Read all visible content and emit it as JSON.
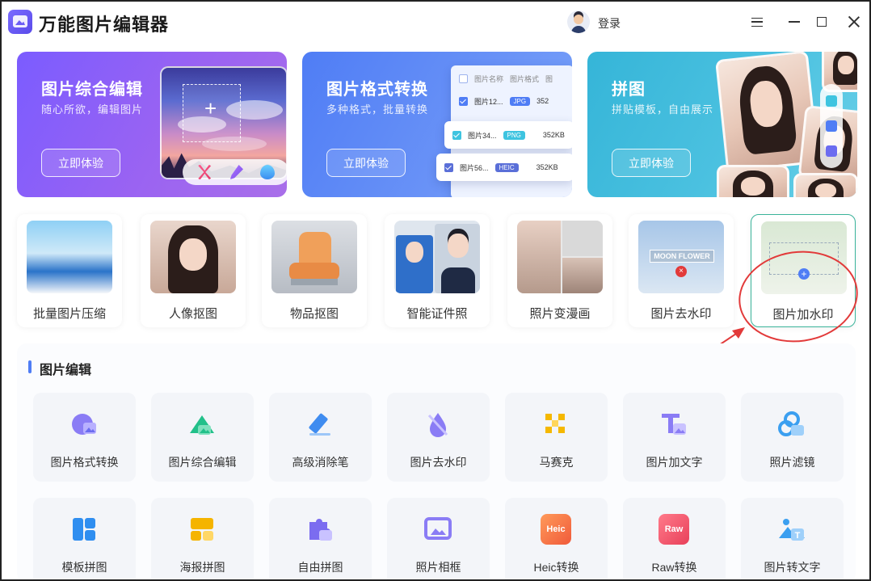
{
  "app": {
    "title": "万能图片编辑器",
    "login": "登录"
  },
  "banners": [
    {
      "title": "图片综合编辑",
      "subtitle": "随心所欲，编辑图片",
      "button": "立即体验"
    },
    {
      "title": "图片格式转换",
      "subtitle": "多种格式，批量转换",
      "button": "立即体验",
      "table": {
        "headers": [
          "图片名称",
          "图片格式",
          "图"
        ],
        "rows": [
          {
            "name": "图片12...",
            "format": "JPG",
            "size": "352",
            "format_color": "#4f7df5"
          },
          {
            "name": "图片34...",
            "format": "PNG",
            "size": "352KB",
            "format_color": "#3ec4e0"
          },
          {
            "name": "图片56...",
            "format": "HEIC",
            "size": "352KB",
            "format_color": "#5a6fd8"
          }
        ]
      }
    },
    {
      "title": "拼图",
      "subtitle": "拼贴模板，自由展示",
      "button": "立即体验"
    }
  ],
  "features": [
    {
      "label": "批量图片压缩",
      "icon": "compress-photo"
    },
    {
      "label": "人像抠图",
      "icon": "portrait-cutout"
    },
    {
      "label": "物品抠图",
      "icon": "object-cutout"
    },
    {
      "label": "智能证件照",
      "icon": "id-photo"
    },
    {
      "label": "照片变漫画",
      "icon": "photo-to-comic"
    },
    {
      "label": "图片去水印",
      "icon": "remove-watermark",
      "watermark_text": "MOON FLOWER"
    },
    {
      "label": "图片加水印",
      "icon": "add-watermark",
      "active": true
    }
  ],
  "section": {
    "title": "图片编辑",
    "row1": [
      {
        "label": "图片格式转换",
        "icon": "format-convert-icon",
        "color": "#6b6cf0"
      },
      {
        "label": "图片综合编辑",
        "icon": "comprehensive-edit-icon",
        "color": "#22c08a"
      },
      {
        "label": "高级消除笔",
        "icon": "eraser-pen-icon",
        "color": "#3f8cf0"
      },
      {
        "label": "图片去水印",
        "icon": "watermark-remove-icon",
        "color": "#7b6cf0"
      },
      {
        "label": "马赛克",
        "icon": "mosaic-icon",
        "color": "#f5b800"
      },
      {
        "label": "图片加文字",
        "icon": "add-text-icon",
        "color": "#7b7cf0"
      },
      {
        "label": "照片滤镜",
        "icon": "photo-filter-icon",
        "color": "#3b9ff0"
      }
    ],
    "row2": [
      {
        "label": "模板拼图",
        "icon": "template-collage-icon",
        "color": "#2f8ef0"
      },
      {
        "label": "海报拼图",
        "icon": "poster-collage-icon",
        "color": "#f5b400"
      },
      {
        "label": "自由拼图",
        "icon": "free-collage-icon",
        "color": "#6b6cf0"
      },
      {
        "label": "照片相框",
        "icon": "photo-frame-icon",
        "color": "#7b6cf0"
      },
      {
        "label": "Heic转换",
        "icon": "heic-convert-icon",
        "color": "#f57a3a",
        "badge": "Heic"
      },
      {
        "label": "Raw转换",
        "icon": "raw-convert-icon",
        "color": "#f0506a",
        "badge": "Raw"
      },
      {
        "label": "图片转文字",
        "icon": "image-to-text-icon",
        "color": "#3b9ff0"
      }
    ]
  }
}
